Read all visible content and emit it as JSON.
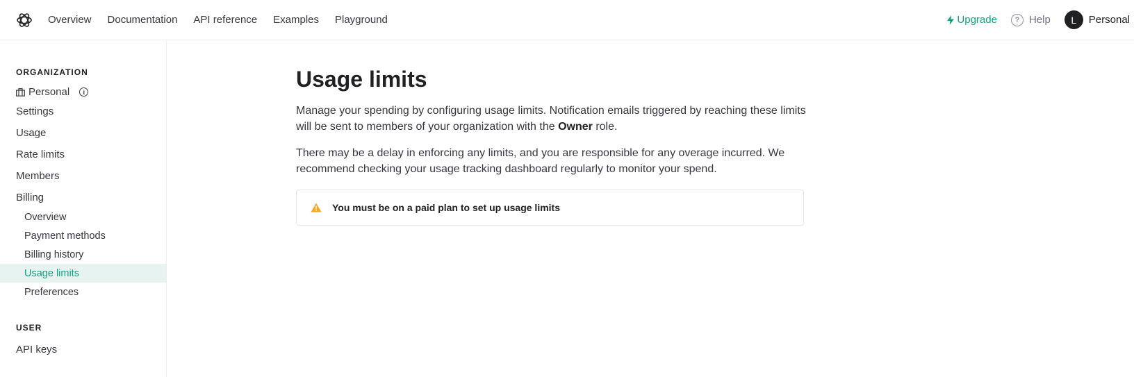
{
  "header": {
    "nav": [
      "Overview",
      "Documentation",
      "API reference",
      "Examples",
      "Playground"
    ],
    "upgrade_label": "Upgrade",
    "help_label": "Help",
    "avatar_initial": "L",
    "account_label": "Personal"
  },
  "sidebar": {
    "org_section_label": "ORGANIZATION",
    "org_name": "Personal",
    "items": [
      "Settings",
      "Usage",
      "Rate limits",
      "Members",
      "Billing"
    ],
    "billing_sub": [
      "Overview",
      "Payment methods",
      "Billing history",
      "Usage limits",
      "Preferences"
    ],
    "active_item": "Usage limits",
    "user_section_label": "USER",
    "user_items": [
      "API keys"
    ]
  },
  "main": {
    "title": "Usage limits",
    "para1_start": "Manage your spending by configuring usage limits. Notification emails triggered by reaching these limits will be sent to members of your organization with the ",
    "para1_bold": "Owner",
    "para1_end": " role.",
    "para2": "There may be a delay in enforcing any limits, and you are responsible for any overage incurred. We recommend checking your usage tracking dashboard regularly to monitor your spend.",
    "alert_text": "You must be on a paid plan to set up usage limits"
  },
  "colors": {
    "accent": "#10a37f",
    "warning": "#f5a623",
    "active_bg": "#e6f3f1"
  },
  "icons": {
    "logo": "openai-logo-icon",
    "upgrade": "lightning-icon",
    "help": "question-circle-icon",
    "org": "briefcase-icon",
    "info": "info-icon",
    "alert": "warning-triangle-icon"
  }
}
